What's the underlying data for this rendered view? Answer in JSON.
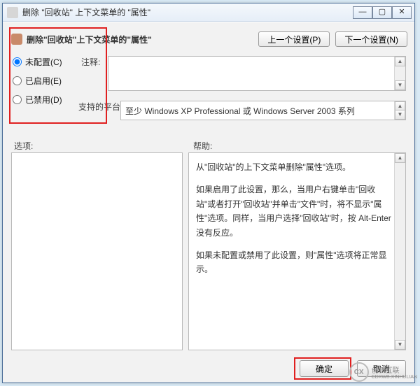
{
  "titlebar": {
    "text": "删除 \"回收站\" 上下文菜单的 \"属性\""
  },
  "header": {
    "text": "删除\"回收站\"上下文菜单的\"属性\"",
    "prev_btn": "上一个设置(P)",
    "next_btn": "下一个设置(N)"
  },
  "radio": {
    "not_configured": "未配置(C)",
    "enabled": "已启用(E)",
    "disabled": "已禁用(D)"
  },
  "labels": {
    "comment": "注释:",
    "platform": "支持的平台:",
    "options": "选项:",
    "help": "帮助:"
  },
  "platform_text": "至少 Windows XP Professional 或 Windows Server 2003 系列",
  "help": {
    "p1": "从\"回收站\"的上下文菜单删除\"属性\"选项。",
    "p2": "如果启用了此设置，那么，当用户右键单击\"回收站\"或者打开\"回收站\"并单击\"文件\"时，将不显示\"属性\"选项。同样，当用户选择\"回收站\"时，按 Alt-Enter 没有反应。",
    "p3": "如果未配置或禁用了此设置，则\"属性\"选项将正常显示。"
  },
  "buttons": {
    "ok": "确定",
    "cancel": "取消"
  },
  "watermark": {
    "logo": "CX",
    "text": "创新互联",
    "sub": "CDXWB.XINHULIAN"
  }
}
